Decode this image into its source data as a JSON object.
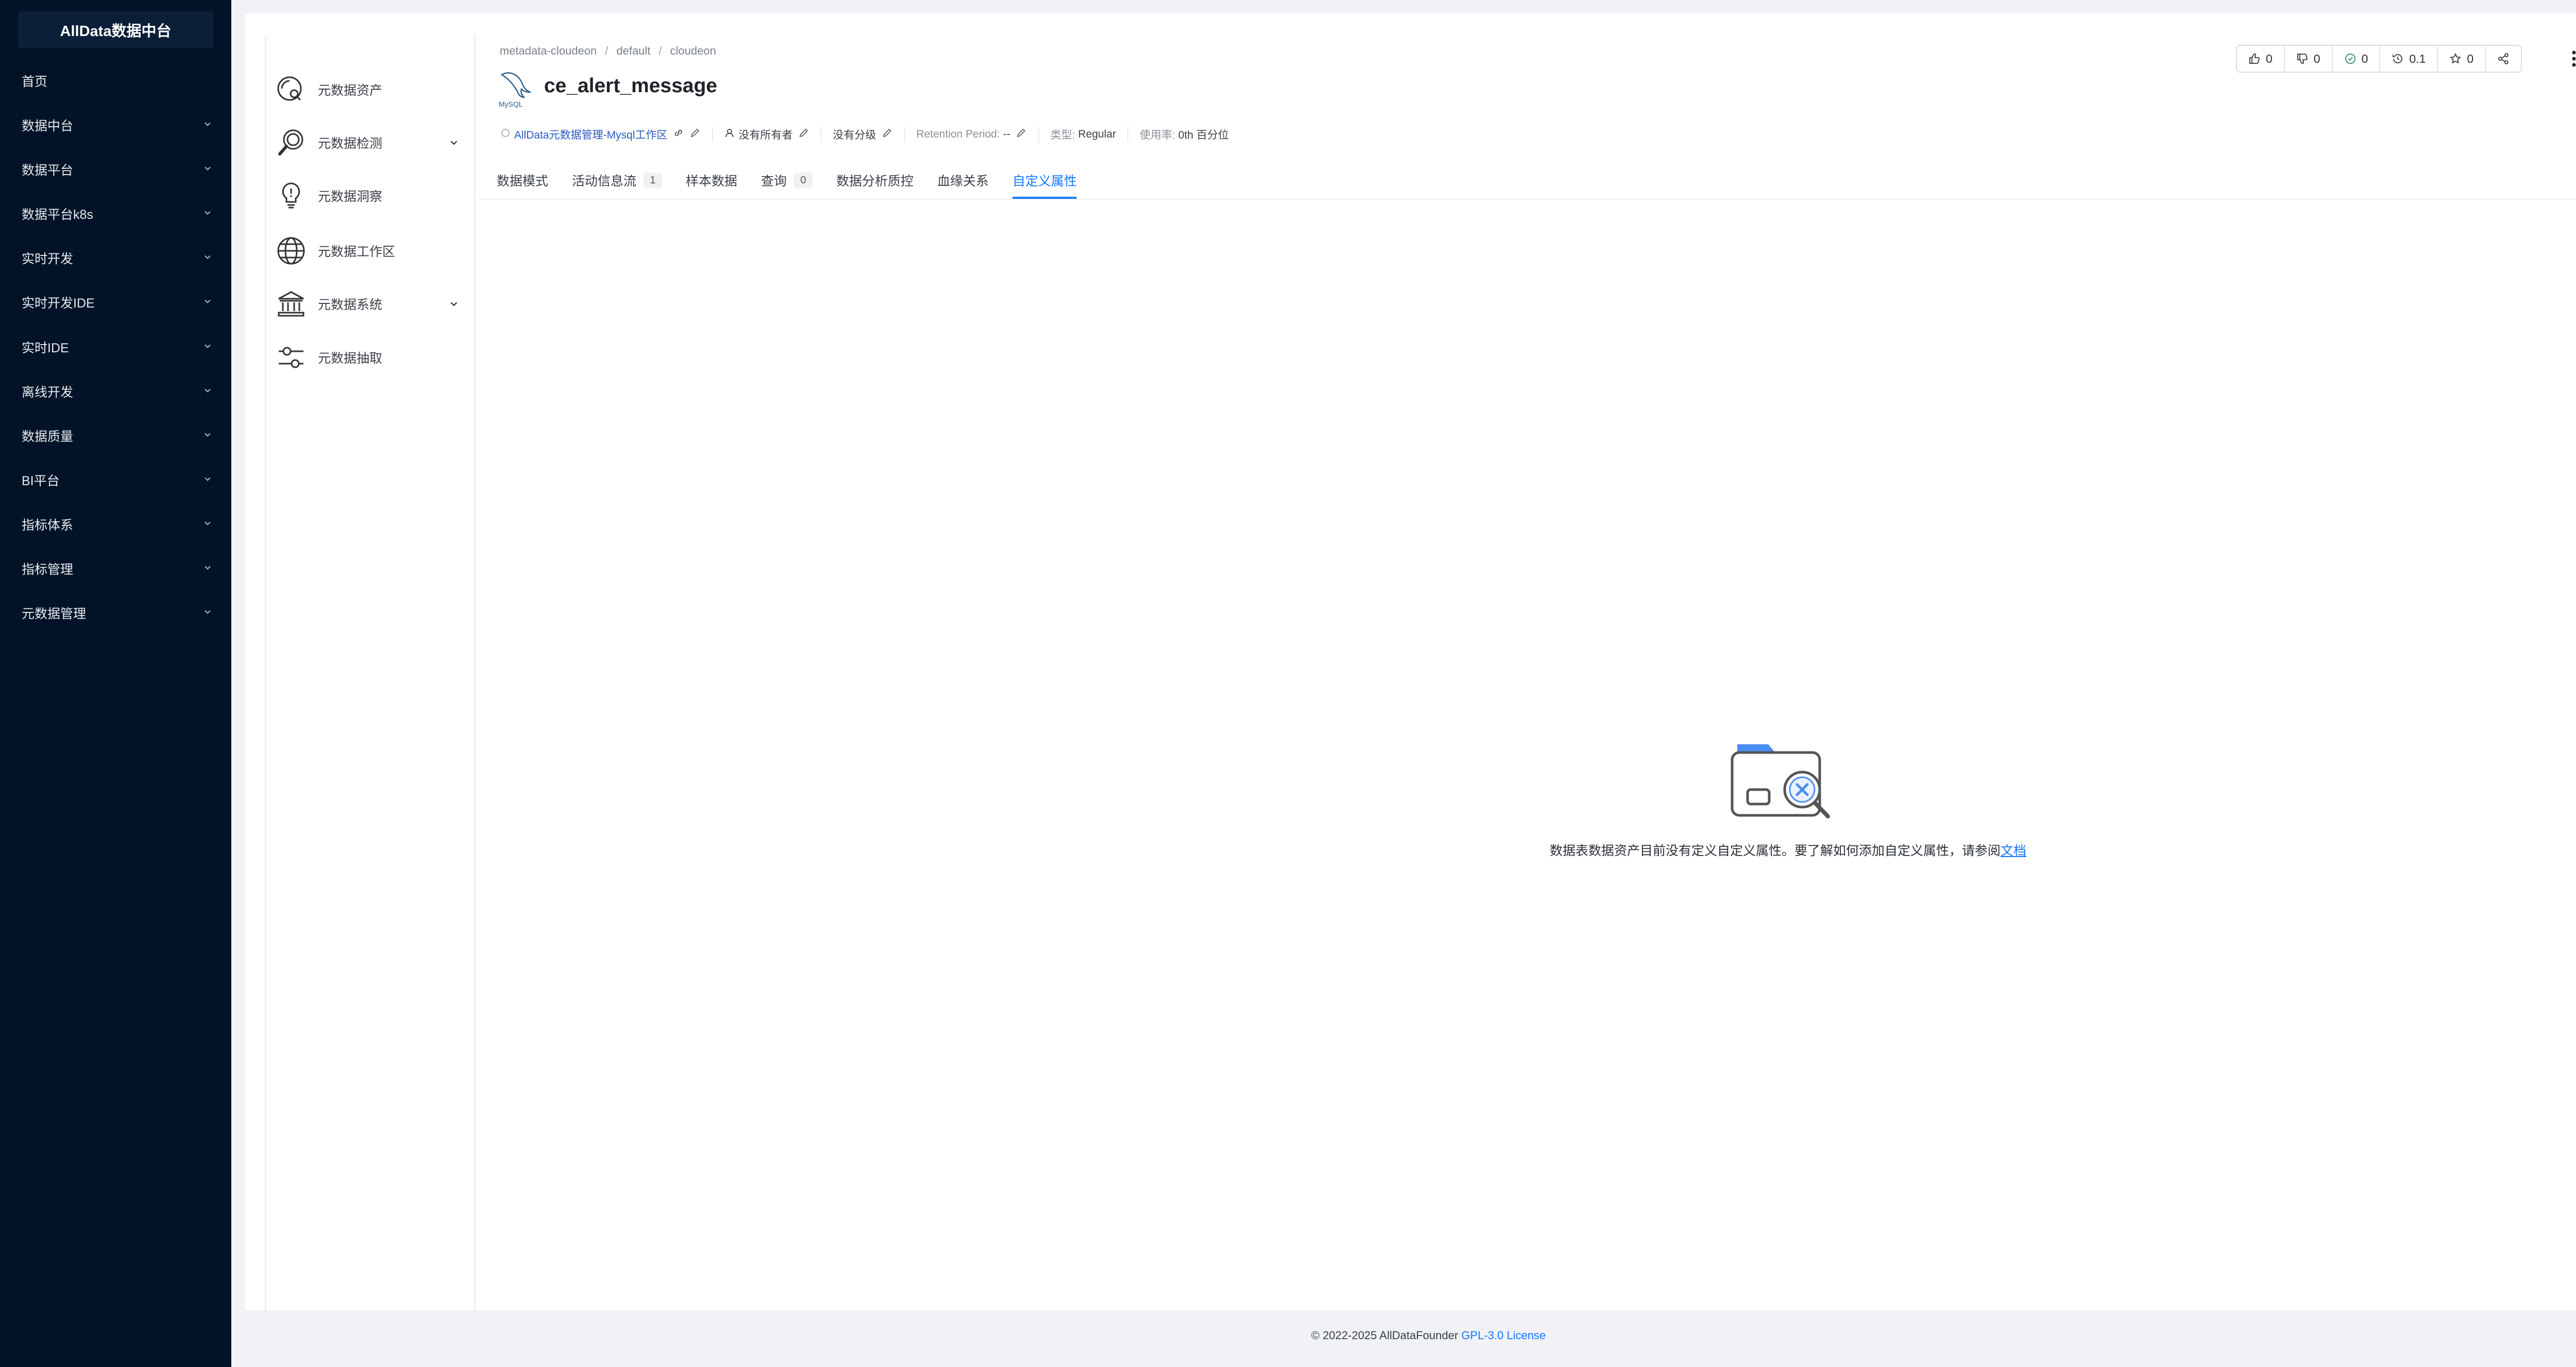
{
  "sidebar": {
    "brand": "AllData数据中台",
    "items": [
      {
        "label": "首页",
        "expandable": false
      },
      {
        "label": "数据中台",
        "expandable": true
      },
      {
        "label": "数据平台",
        "expandable": true
      },
      {
        "label": "数据平台k8s",
        "expandable": true
      },
      {
        "label": "实时开发",
        "expandable": true
      },
      {
        "label": "实时开发IDE",
        "expandable": true
      },
      {
        "label": "实时IDE",
        "expandable": true
      },
      {
        "label": "离线开发",
        "expandable": true
      },
      {
        "label": "数据质量",
        "expandable": true
      },
      {
        "label": "BI平台",
        "expandable": true
      },
      {
        "label": "指标体系",
        "expandable": true
      },
      {
        "label": "指标管理",
        "expandable": true
      },
      {
        "label": "元数据管理",
        "expandable": true
      }
    ]
  },
  "subnav": {
    "items": [
      {
        "label": "元数据资产",
        "icon": "asset-search-icon"
      },
      {
        "label": "元数据检测",
        "icon": "magnifier-icon",
        "expandable": true
      },
      {
        "label": "元数据洞察",
        "icon": "lightbulb-icon"
      },
      {
        "label": "元数据工作区",
        "icon": "globe-icon"
      },
      {
        "label": "元数据系统",
        "icon": "bank-icon",
        "expandable": true
      },
      {
        "label": "元数据抽取",
        "icon": "sliders-icon"
      }
    ]
  },
  "breadcrumb": [
    "metadata-cloudeon",
    "default",
    "cloudeon"
  ],
  "table": {
    "name": "ce_alert_message",
    "logo_text": "MySQL"
  },
  "meta": {
    "domain_link": "AllData元数据管理-Mysql工作区",
    "owner": "没有所有者",
    "tier": "没有分级",
    "retention_key": "Retention Period:",
    "retention_value": "--",
    "type_key": "类型:",
    "type_value": "Regular",
    "usage_key": "使用率:",
    "usage_value": "0th 百分位"
  },
  "actions": {
    "likes": "0",
    "dislikes": "0",
    "tasks": "0",
    "version": "0.1",
    "follows": "0"
  },
  "tabs": [
    {
      "label": "数据模式",
      "badge": null,
      "active": false
    },
    {
      "label": "活动信息流",
      "badge": "1",
      "active": false
    },
    {
      "label": "样本数据",
      "badge": null,
      "active": false
    },
    {
      "label": "查询",
      "badge": "0",
      "active": false
    },
    {
      "label": "数据分析质控",
      "badge": null,
      "active": false
    },
    {
      "label": "血缘关系",
      "badge": null,
      "active": false
    },
    {
      "label": "自定义属性",
      "badge": null,
      "active": true
    }
  ],
  "empty_state": {
    "message": "数据表数据资产目前没有定义自定义属性。要了解如何添加自定义属性，请参阅",
    "link": "文档"
  },
  "footer": {
    "copyright": "© 2022-2025 AllDataFounder",
    "license": "GPL-3.0 License"
  },
  "colors": {
    "sidebar_bg": "#021327",
    "accent": "#1677ff",
    "link": "#2b59c3"
  }
}
